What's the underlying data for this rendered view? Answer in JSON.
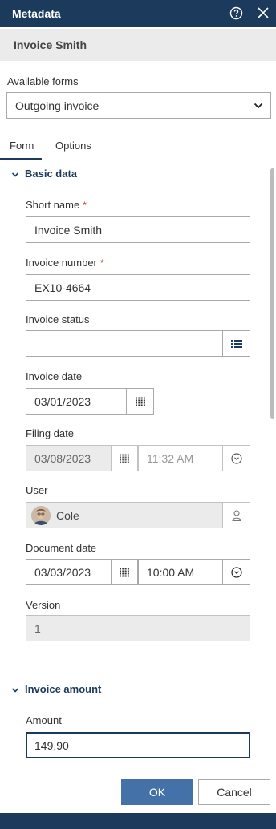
{
  "titlebar": {
    "title": "Metadata",
    "help_icon": "help-circle-icon",
    "close_icon": "close-icon"
  },
  "document": {
    "title": "Invoice Smith"
  },
  "forms": {
    "label": "Available forms",
    "selected": "Outgoing invoice"
  },
  "tabs": [
    {
      "label": "Form",
      "active": true
    },
    {
      "label": "Options",
      "active": false
    }
  ],
  "sections": {
    "basic": {
      "title": "Basic data",
      "short_name": {
        "label": "Short name",
        "required": "*",
        "value": "Invoice Smith"
      },
      "invoice_number": {
        "label": "Invoice number",
        "required": "*",
        "value": "EX10-4664"
      },
      "invoice_status": {
        "label": "Invoice status",
        "value": ""
      },
      "invoice_date": {
        "label": "Invoice date",
        "value": "03/01/2023"
      },
      "filing_date": {
        "label": "Filing date",
        "date": "03/08/2023",
        "time": "11:32 AM"
      },
      "user": {
        "label": "User",
        "value": "Cole"
      },
      "document_date": {
        "label": "Document date",
        "date": "03/03/2023",
        "time": "10:00 AM"
      },
      "version": {
        "label": "Version",
        "value": "1"
      }
    },
    "amount": {
      "title": "Invoice amount",
      "amount": {
        "label": "Amount",
        "value": "149,90"
      }
    }
  },
  "buttons": {
    "ok": "OK",
    "cancel": "Cancel"
  },
  "colors": {
    "header": "#1b3a5c",
    "primary_button": "#4472a8",
    "accent": "#1b3a5c"
  }
}
